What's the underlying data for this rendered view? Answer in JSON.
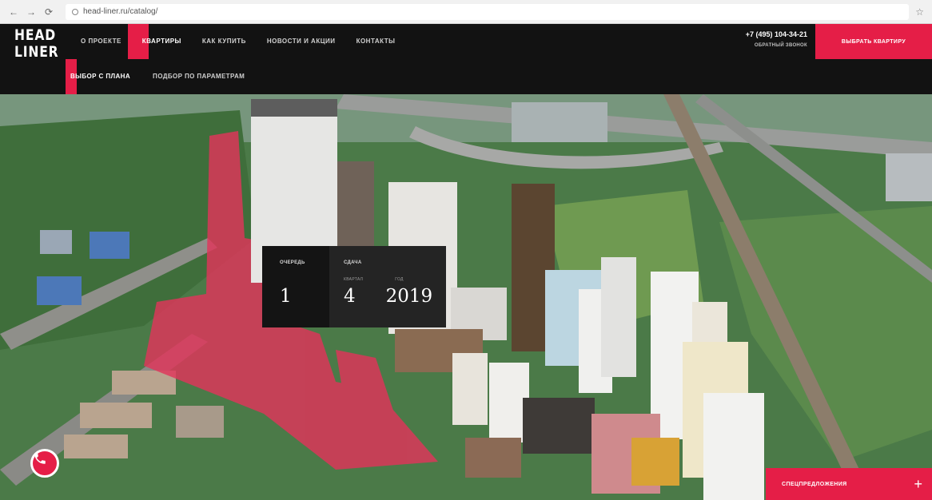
{
  "browser": {
    "url": "head-liner.ru/catalog/"
  },
  "logo": {
    "line1": "HEAD",
    "line2": "LINER"
  },
  "nav": {
    "items": [
      {
        "label": "О ПРОЕКТЕ"
      },
      {
        "label": "КВАРТИРЫ"
      },
      {
        "label": "КАК КУПИТЬ"
      },
      {
        "label": "НОВОСТИ И АКЦИИ"
      },
      {
        "label": "КОНТАКТЫ"
      }
    ],
    "active": "КВАРТИРЫ"
  },
  "subnav": {
    "items": [
      {
        "label": "ВЫБОР С ПЛАНА"
      },
      {
        "label": "ПОДБОР ПО ПАРАМЕТРАМ"
      }
    ],
    "active": "ВЫБОР С ПЛАНА"
  },
  "contact": {
    "phone": "+7 (495) 104-34-21",
    "callback": "ОБРАТНЫЙ ЗВОНОК"
  },
  "cta": {
    "label": "ВЫБРАТЬ КВАРТИРУ"
  },
  "info_panel": {
    "queue_label": "ОЧЕРЕДЬ",
    "queue_value": "1",
    "delivery_label": "СДАЧА",
    "quarter_label": "КВАРТАЛ",
    "quarter_value": "4",
    "year_label": "ГОД",
    "year_value": "2019"
  },
  "special_offers": {
    "label": "СПЕЦПРЕДЛОЖЕНИЯ",
    "plus": "+"
  },
  "icons": {
    "phone": "phone-icon",
    "plus": "plus-icon"
  },
  "colors": {
    "accent": "#e51e47",
    "header_bg": "#121212"
  }
}
